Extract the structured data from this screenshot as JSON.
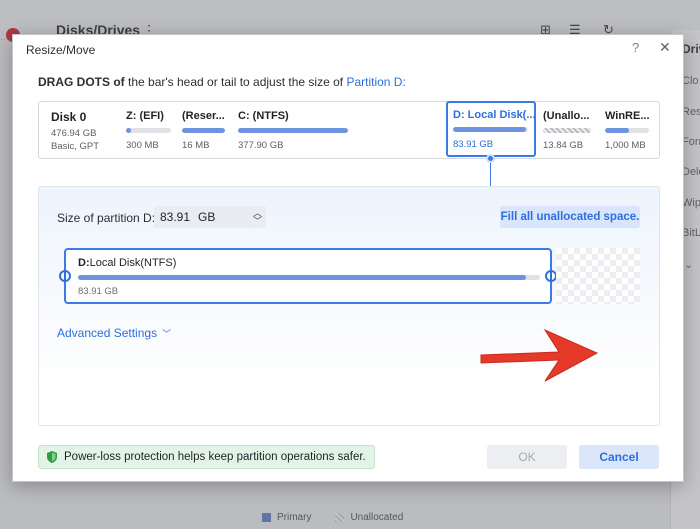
{
  "background": {
    "title": "Disks/Drives",
    "right_panel": {
      "title": "Drive",
      "items": [
        "Clo",
        "Resi",
        "Forr",
        "Dele",
        "Wip",
        "BitL"
      ]
    },
    "legend": {
      "primary": "Primary",
      "unallocated": "Unallocated"
    },
    "accent_color": "#c8202f"
  },
  "dialog": {
    "title": "Resize/Move",
    "instruction": {
      "bold": "DRAG DOTS of",
      "text": " the bar's head or tail to adjust the size of ",
      "target": "Partition D:"
    },
    "disk": {
      "name": "Disk 0",
      "size": "476.94 GB",
      "type": "Basic, GPT"
    },
    "partitions": [
      {
        "name": "Z: (EFI)",
        "size": "300 MB",
        "used_fraction": 0.1
      },
      {
        "name": "(Reser...",
        "size": "16 MB",
        "used_fraction": 1.0
      },
      {
        "name": "C: (NTFS)",
        "size": "377.90 GB",
        "used_fraction": 1.0
      },
      {
        "name": "D: Local Disk(...",
        "size": "83.91 GB",
        "used_fraction": 0.97,
        "selected": true
      },
      {
        "name": "(Unallo...",
        "size": "13.84 GB",
        "unallocated": true
      },
      {
        "name": "WinRE...",
        "size": "1,000 MB",
        "used_fraction": 0.55
      }
    ],
    "size_field": {
      "label": "Size of partition D:",
      "value": "83.91",
      "unit": "GB"
    },
    "fill_button": "Fill all unallocated space.",
    "resize_partition": {
      "letter": "D:",
      "name": "Local Disk(NTFS)",
      "size": "83.91 GB",
      "used_fraction": 0.97
    },
    "advanced_settings": "Advanced Settings",
    "protection_text": "Power-loss protection helps keep partition operations safer.",
    "ok_label": "OK",
    "cancel_label": "Cancel",
    "colors": {
      "accent": "#2d6fde",
      "bar": "#6e93e0",
      "arrow": "#e5392a",
      "protection_bg": "#e3f3e6"
    }
  }
}
